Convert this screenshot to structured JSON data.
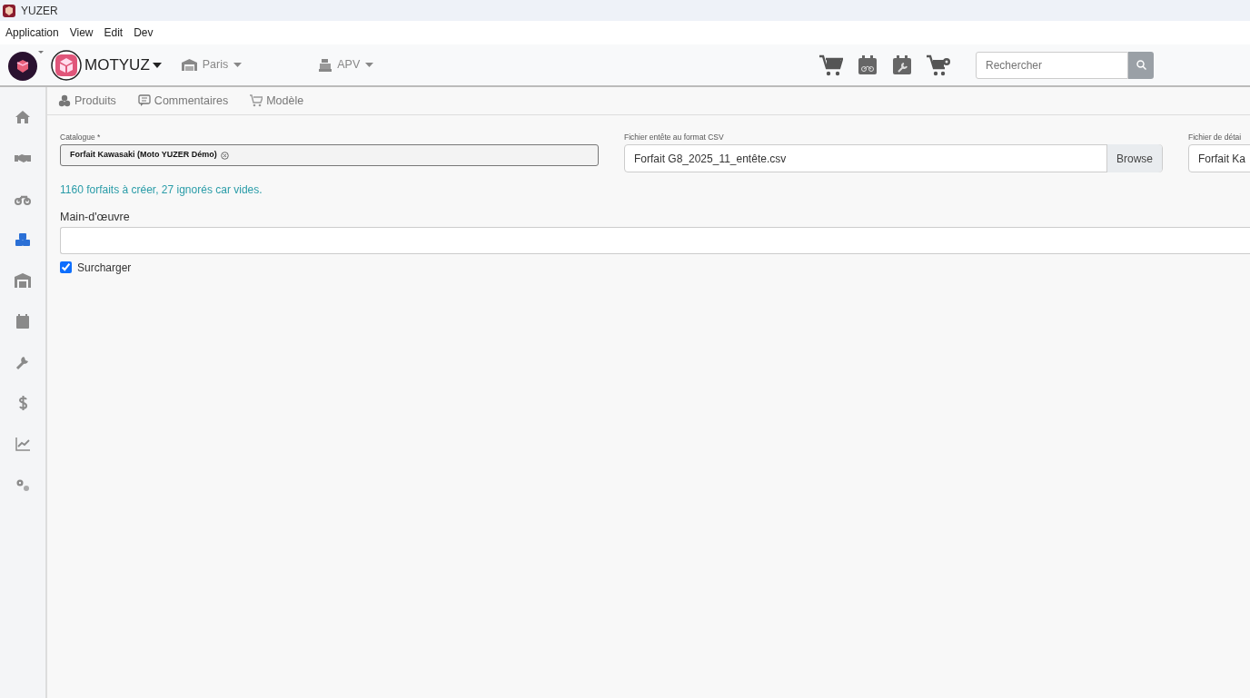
{
  "window": {
    "title": "YUZER"
  },
  "menu": [
    "Application",
    "View",
    "Edit",
    "Dev"
  ],
  "header": {
    "brand": "MOTYUZ",
    "site": "Paris",
    "mode": "APV",
    "search": {
      "placeholder": "Rechercher"
    }
  },
  "sidebar": {
    "items": [
      {
        "selected": false
      },
      {
        "selected": false
      },
      {
        "selected": false
      },
      {
        "selected": true
      },
      {
        "selected": false
      },
      {
        "selected": false
      },
      {
        "selected": false
      },
      {
        "selected": false
      },
      {
        "selected": false
      },
      {
        "selected": false
      }
    ]
  },
  "tabs": [
    {
      "label": "Produits",
      "selected": false
    },
    {
      "label": "Commentaires",
      "selected": false
    },
    {
      "label": "Modèle",
      "selected": false
    }
  ],
  "form": {
    "catalogue": {
      "label": "Catalogue *",
      "tag": "Forfait Kawasaki (Moto YUZER Démo)"
    },
    "header_file": {
      "label": "Fichier entête au format CSV",
      "value": "Forfait G8_2025_11_entête.csv",
      "button": "Browse"
    },
    "detail_file": {
      "label": "Fichier de détai",
      "value": "Forfait Ka"
    },
    "info": "1160 forfaits à créer, 27 ignorés car vides.",
    "labour": {
      "label": "Main-d'œuvre"
    },
    "override": {
      "label": "Surcharger",
      "checked": true
    }
  }
}
